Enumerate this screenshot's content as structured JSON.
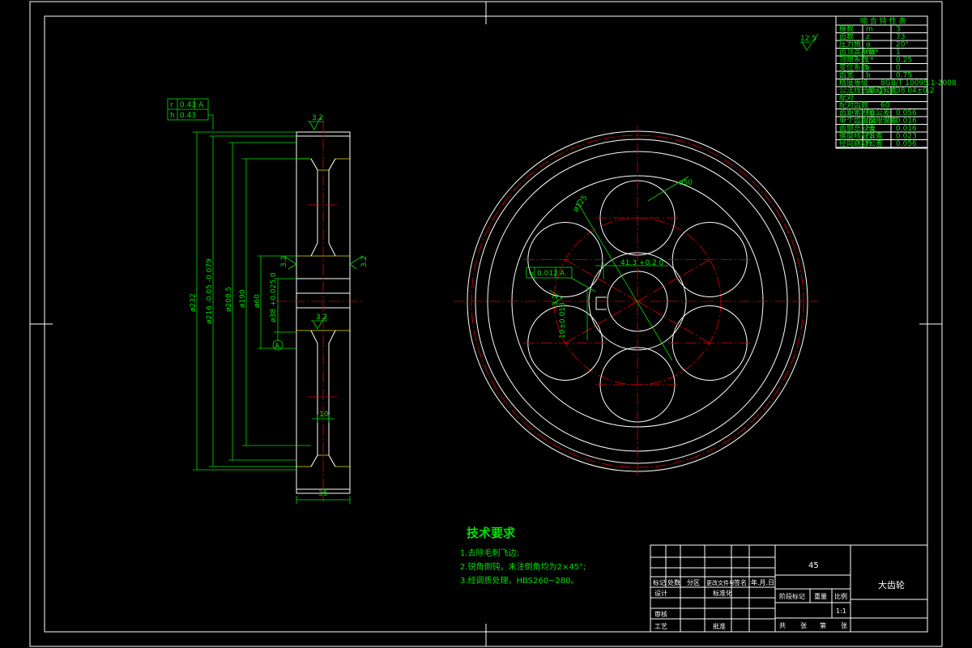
{
  "colors": {
    "background": "#000000",
    "outline": "#ffffff",
    "dimension": "#00e000",
    "centerline": "#e00000",
    "hatch": "#e0e000"
  },
  "surface_finish": {
    "general": "12.5",
    "side_face": "3.2",
    "bore_left": "3.2",
    "bore_right": "3.2",
    "keyway": "3.2"
  },
  "tolerance_frame": {
    "row1_symbol": "r",
    "row1_value": "0.43",
    "row1_datum": "A",
    "row2_symbol": "h",
    "row2_value": "0.43"
  },
  "side_view_dims": {
    "d_outer": "ø232",
    "d_tip": "ø216 -0.05 -0.079",
    "d_ring": "ø208.5",
    "d_web": "ø190",
    "d_hub": "ø60",
    "d_bore": "ø38 +0.025 0",
    "rib": "10",
    "width": "35",
    "datum": "A"
  },
  "front_view_dims": {
    "hole_dia": "ø50",
    "hole_pcd": "ø125",
    "keyway_depth": "41.3 +0.2 0",
    "keyway_width": "10±0.018",
    "sym_frame_symbol": "=",
    "sym_frame_value": "0.012",
    "sym_frame_datum": "A",
    "keyway_roughness": "3.2"
  },
  "param_table": {
    "title": "啮 合 特 性 表",
    "rows": [
      {
        "name": "模数",
        "sym": "m",
        "val": "3"
      },
      {
        "name": "齿数",
        "sym": "z",
        "val": "73"
      },
      {
        "name": "压力角",
        "sym": "α",
        "val": "20°"
      },
      {
        "name": "齿顶高系数",
        "sym": "ha*",
        "val": "1"
      },
      {
        "name": "顶隙系数",
        "sym": "c*",
        "val": "0.25"
      },
      {
        "name": "变位系数",
        "sym": "x",
        "val": "0"
      },
      {
        "name": "齿宽",
        "sym": "b",
        "val": "0.75"
      }
    ],
    "accuracy": {
      "name": "精度等级",
      "val": "8GB/T 10095.1-2008"
    },
    "length_row": {
      "name": "公法线长度及公差",
      "sym": "W=∑n",
      "val": "38.04±0.2"
    },
    "pair_row": {
      "name": "配对",
      "val": ""
    },
    "pair_teeth": {
      "name": "配对齿数",
      "val": "60"
    },
    "tolerances": [
      {
        "name": "齿距累积总公差",
        "sym": "Fp",
        "val": "0.056"
      },
      {
        "name": "单个齿距极限偏差",
        "sym": "fpt",
        "val": "0.016"
      },
      {
        "name": "齿廓总公差",
        "sym": "Fα",
        "val": "0.016"
      },
      {
        "name": "螺旋线总公差",
        "sym": "Fβ",
        "val": "0.023"
      },
      {
        "name": "径向跳动公差",
        "sym": "Fr",
        "val": "0.056"
      }
    ]
  },
  "technical_requirements": {
    "title": "技术要求",
    "items": [
      "1.去除毛刺飞边;",
      "2.锐角倒钝，未注倒角均为2×45°;",
      "3.经调质处理，HBS260~280。"
    ]
  },
  "title_block": {
    "material": "45",
    "part_name": "大齿轮",
    "change_headers": [
      "标记",
      "处数",
      "分区",
      "更改文件号",
      "签名",
      "年.月.日"
    ],
    "design": "设计",
    "standardize": "标准化",
    "check": "审核",
    "process": "工艺",
    "approve": "批准",
    "stage_mark": "阶段标记",
    "weight": "重量",
    "scale_label": "比例",
    "scale": "1:1",
    "sheet_info": [
      "共",
      "张",
      "第",
      "张"
    ]
  }
}
